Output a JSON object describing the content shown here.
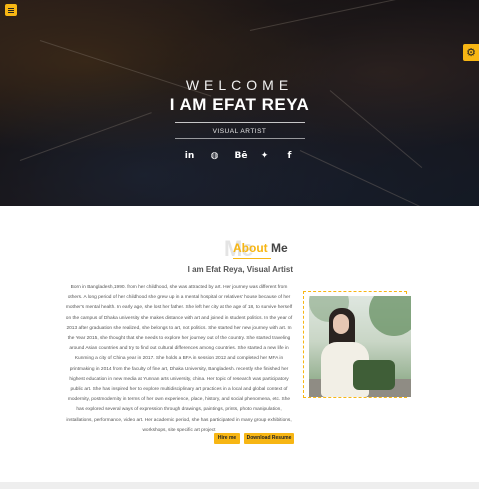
{
  "hero": {
    "welcome": "WELCOME",
    "name": "I AM EFAT REYA",
    "role": "VISUAL ARTIST",
    "socials": [
      {
        "icon": "linkedin-icon",
        "glyph": "in"
      },
      {
        "icon": "globe-icon",
        "glyph": "◍"
      },
      {
        "icon": "behance-icon",
        "glyph": "Bē"
      },
      {
        "icon": "twitter-icon",
        "glyph": "✦"
      },
      {
        "icon": "facebook-icon",
        "glyph": "f"
      }
    ]
  },
  "about": {
    "ghost_text": "Me",
    "title_accent": "About",
    "title_rest": " Me",
    "subtitle": "I am Efat Reya, Visual Artist",
    "bio": "Born in Bangladesh,1990. from her childhood, she was attracted by art. Her journey was different from others. A long period of her childhood she grew up in a mental hospital or relatives' house because of her mother's mental health. In early age, she lost her father. She left her city at the age of 18, to survive herself on the campus of Dhaka university she makes distance with art and joined in student politics. In the year of 2013 after graduation she realized, she belongs to art, not politics. She started her new journey with art. In the Year 2015, she thought that she needs to explore her journey out of the country. She started traveling around Asian countries and try to find out cultural differences among countries. She started a new life in Kunming a city of China year in 2017. She holds a BFA in session 2012 and completed her MFA in printmaking in 2014 from the faculty of fine art, Dhaka University, Bangladesh. recently she finished her highest education in new media at Yunnan arts university, china. Her topic of research was participatory public art. She has inspired her to explore multidisciplinary art practices in a local and global context of modernity, postmodernity in terms of her own experience, place, history, and social phenomena, etc. She has explored several ways of expression through drawings, paintings, prints, photo manipulation, installations, performance, video art. Her academic period, she has participated in many group exhibitions, workshops, site specific art project",
    "hire_label": "Hire me",
    "download_label": "Download Resume"
  },
  "colors": {
    "accent": "#f7b614",
    "text": "#555555"
  }
}
